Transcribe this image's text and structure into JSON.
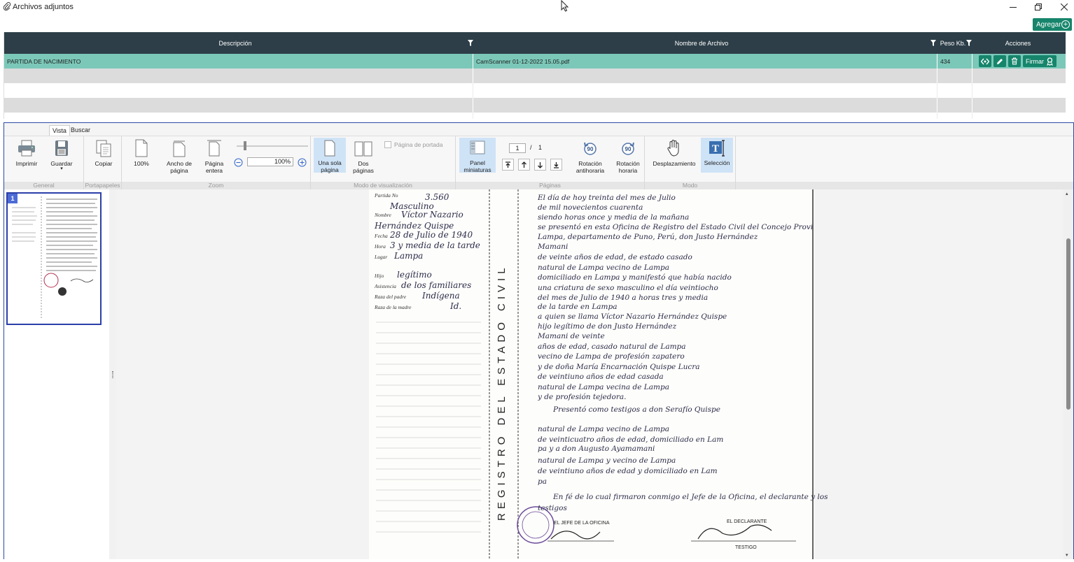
{
  "window": {
    "title": "Archivos adjuntos",
    "controls": [
      "minimize-icon",
      "restore-icon",
      "close-icon"
    ]
  },
  "toolbar": {
    "add_label": "Agregar"
  },
  "grid": {
    "columns": [
      "Descripción",
      "Nombre de Archivo",
      "Peso Kb.",
      "Acciones"
    ],
    "rows": [
      {
        "descripcion": "PARTIDA DE NACIMIENTO",
        "archivo": "CamScanner 01-12-2022 15.05.pdf",
        "peso": "434",
        "firmar": "Firmar"
      }
    ]
  },
  "viewer": {
    "tabs": [
      "Vista",
      "Buscar"
    ],
    "groups": {
      "general": "General",
      "portapapeles": "Portapapeles",
      "zoom": "Zoom",
      "modo_visualizacion": "Modo de visualización",
      "paginas": "Páginas",
      "modo": "Modo"
    },
    "buttons": {
      "imprimir": "Imprimir",
      "guardar": "Guardar",
      "copiar": "Copiar",
      "zoom100": "100%",
      "ancho_pagina": "Ancho de página",
      "pagina_entera": "Página entera",
      "zoom_value": "100%",
      "una_sola_pagina": "Una sola página",
      "dos_paginas": "Dos páginas",
      "pagina_portada": "Página de portada",
      "panel_miniaturas": "Panel miniaturas",
      "rotacion_antihoraria": "Rotación antihoraria",
      "rotacion_horaria": "Rotación horaria",
      "desplazamiento": "Desplazamiento",
      "seleccion": "Selección"
    },
    "page_current": "1",
    "page_sep": "/",
    "page_total": "1",
    "zoom_slider_level": 0.12,
    "thumbnail_number": "1"
  },
  "document": {
    "left_col": [
      "Partida No",
      "3.560",
      "Masculino",
      "Nombre",
      "Víctor Nazario",
      "Hernández Quispe",
      "Fecha",
      "28 de Julio de 1940",
      "Hora",
      "3 y media de la tarde",
      "Lugar",
      "Lampa",
      "Hijo",
      "legítimo",
      "Asistencia",
      "de los familiares",
      "Raza del padre",
      "Indígena",
      "Raza de la madre",
      "Id."
    ],
    "vertical_title": "REGISTRO DEL ESTADO CIVIL",
    "right_lines": [
      "El día de hoy  treinta  del mes de  Julio",
      "de mil novecientos  cuarenta",
      "siendo horas  once y media  de la mañana",
      "se presentó en esta Oficina de Registro del Estado Civil del Concejo Provincial de",
      "Lampa, departamento de Puno, Perú, don  Justo Hernández",
      "Mamani",
      "de  veinte  años de edad, de estado  casado",
      "natural de  Lampa  vecino de  Lampa",
      "domiciliado en  Lampa  y manifestó que había nacido",
      "una criatura de sexo  masculino  el día  veintiocho",
      "del mes de  Julio de 1940  a horas  tres y media",
      "de la tarde  en  Lampa",
      "a quien se llama  Víctor Nazario Hernández Quispe",
      "hijo  legítimo  de don  Justo Hernández",
      "Mamani  de  veinte",
      "años de edad,  casado  natural de  Lampa",
      "vecino de  Lampa  de profesión  zapatero",
      "y de doña  María Encarnación Quispe Lucra",
      "de  veintiuno  años de edad  casada",
      "natural de  Lampa  vecina de  Lampa",
      "y de profesión  tejedora.",
      "Presentó como testigos a don  Serafío Quispe",
      "natural de  Lampa  vecino de  Lampa",
      "de  veinticuatro  años de edad, domiciliado en  Lam",
      "pa  y a don  Augusto Ayamamani",
      "natural de  Lampa  y vecino de  Lampa",
      "de  veintiuno  años de edad y domiciliado en  Lam",
      "pa",
      "En fé de lo cual firmaron conmigo el Jefe de la Oficina, el declarante y los",
      "testigos"
    ],
    "sign_left": "EL JEFE DE LA OFICINA",
    "sign_right": "EL DECLARANTE",
    "testigo": "TESTIGO"
  }
}
